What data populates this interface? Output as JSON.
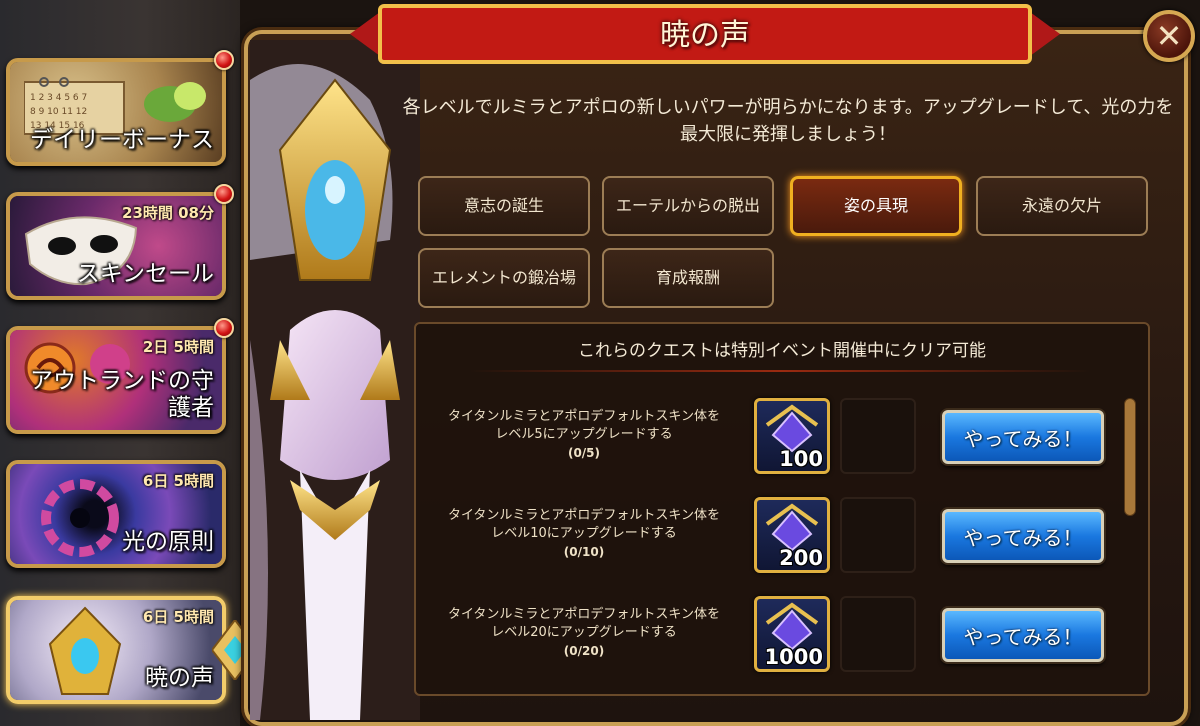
{
  "sidebar": {
    "items": [
      {
        "name": "デイリーボーナス",
        "timer": ""
      },
      {
        "name": "スキンセール",
        "timer": "23時間 08分"
      },
      {
        "name": "アウトランドの守\n護者",
        "timer": "2日 5時間"
      },
      {
        "name": "光の原則",
        "timer": "6日 5時間"
      },
      {
        "name": "暁の声",
        "timer": "6日 5時間"
      }
    ]
  },
  "header": {
    "title": "暁の声",
    "close_label": "✕"
  },
  "description": "各レベルでルミラとアポロの新しいパワーが明らかになります。アップグレードして、光の力を最大限に発揮しましょう！",
  "tabs": [
    {
      "label": "意志の誕生"
    },
    {
      "label": "エーテルからの脱出"
    },
    {
      "label": "姿の具現"
    },
    {
      "label": "永遠の欠片"
    },
    {
      "label": "エレメントの鍛冶場"
    },
    {
      "label": "育成報酬"
    }
  ],
  "quests": {
    "header": "これらのクエストは特別イベント開催中にクリア可能",
    "items": [
      {
        "line1": "タイタンルミラとアポロデフォルトスキン体を",
        "line2": "レベル5にアップグレードする",
        "progress": "(0/5)",
        "reward": "100",
        "button": "やってみる！"
      },
      {
        "line1": "タイタンルミラとアポロデフォルトスキン体を",
        "line2": "レベル10にアップグレードする",
        "progress": "(0/10)",
        "reward": "200",
        "button": "やってみる！"
      },
      {
        "line1": "タイタンルミラとアポロデフォルトスキン体を",
        "line2": "レベル20にアップグレードする",
        "progress": "(0/20)",
        "reward": "1000",
        "button": "やってみる！"
      }
    ]
  },
  "colors": {
    "accent": "#f0b020",
    "button": "#1a78e0",
    "badge": "#d21414",
    "frame": "#c9a055"
  }
}
